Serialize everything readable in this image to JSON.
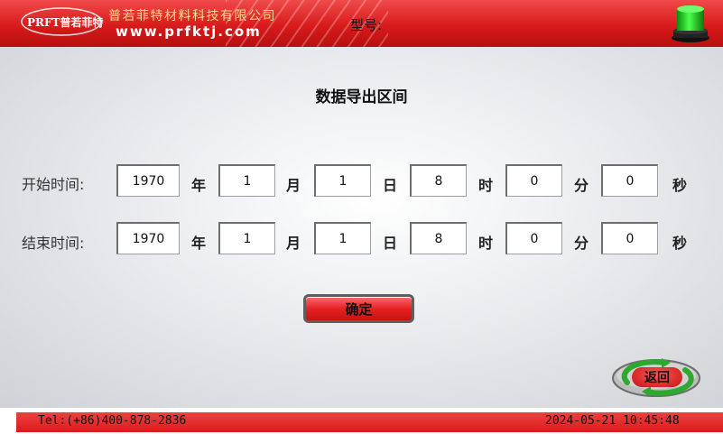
{
  "header": {
    "logo_text": "PRFT普若菲特",
    "company_name": "普若菲特材料科技有限公司",
    "website": "www.prfktj.com",
    "model_label": "型号:"
  },
  "main": {
    "title": "数据导出区间",
    "start": {
      "label": "开始时间:",
      "year": "1970",
      "month": "1",
      "day": "1",
      "hour": "8",
      "minute": "0",
      "second": "0"
    },
    "end": {
      "label": "结束时间:",
      "year": "1970",
      "month": "1",
      "day": "1",
      "hour": "8",
      "minute": "0",
      "second": "0"
    },
    "units": {
      "year": "年",
      "month": "月",
      "day": "日",
      "hour": "时",
      "minute": "分",
      "second": "秒"
    },
    "confirm_label": "确定",
    "back_label": "返回"
  },
  "footer": {
    "tel": "Tel:(+86)400-878-2836",
    "datetime": "2024-05-21 10:45:48"
  },
  "colors": {
    "header_red": "#d81b1b",
    "status_green": "#22cc22",
    "button_red": "#e62222"
  }
}
